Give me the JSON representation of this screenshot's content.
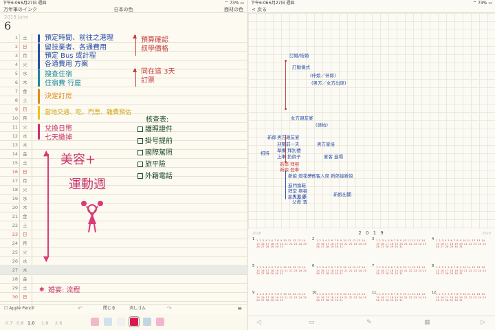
{
  "left": {
    "status": {
      "time": "下午6:06",
      "date": "6月27日 週四",
      "battery": "73%"
    },
    "nav": {
      "left": "万年筆のインク",
      "center": "日本の色",
      "right": "面材の色"
    },
    "year": "2019 June",
    "month": "6",
    "days": [
      {
        "n": "1",
        "w": "土"
      },
      {
        "n": "2",
        "w": "日"
      },
      {
        "n": "3",
        "w": "月"
      },
      {
        "n": "4",
        "w": "火"
      },
      {
        "n": "5",
        "w": "水"
      },
      {
        "n": "6",
        "w": "木"
      },
      {
        "n": "7",
        "w": "金"
      },
      {
        "n": "8",
        "w": "土"
      },
      {
        "n": "9",
        "w": "日"
      },
      {
        "n": "10",
        "w": "月"
      },
      {
        "n": "11",
        "w": "火"
      },
      {
        "n": "12",
        "w": "水"
      },
      {
        "n": "13",
        "w": "木"
      },
      {
        "n": "14",
        "w": "金"
      },
      {
        "n": "15",
        "w": "土"
      },
      {
        "n": "16",
        "w": "日"
      },
      {
        "n": "17",
        "w": "月"
      },
      {
        "n": "18",
        "w": "火"
      },
      {
        "n": "19",
        "w": "水"
      },
      {
        "n": "20",
        "w": "木"
      },
      {
        "n": "21",
        "w": "金"
      },
      {
        "n": "22",
        "w": "土"
      },
      {
        "n": "23",
        "w": "日"
      },
      {
        "n": "24",
        "w": "月"
      },
      {
        "n": "25",
        "w": "火"
      },
      {
        "n": "26",
        "w": "水"
      },
      {
        "n": "27",
        "w": "木"
      },
      {
        "n": "28",
        "w": "金"
      },
      {
        "n": "29",
        "w": "土"
      },
      {
        "n": "30",
        "w": "日"
      }
    ],
    "notes": {
      "n1": "預定時間、前往之港理",
      "n2": "留技業者、各通費用",
      "n3": "預定 Bus 或計程",
      "n4": "各通費用 方案",
      "n5": "搜查住宿",
      "n6": "住宿費 行屋",
      "n7": "決定訂房",
      "n8": "當地交通、吃、門票、雜費預估",
      "n9": "兌換日幣",
      "n10": "七天繳掉",
      "arrow1": "預算確認",
      "arrow1b": "叔學價格",
      "arrow2": "同在這 3天",
      "arrow2b": "訂票",
      "big1": "美容+",
      "big2": "運動週",
      "checklist_title": "核查表:",
      "check": [
        "護照證件",
        "掛号提前",
        "國際駕照",
        "旅平險",
        "外籍電話"
      ],
      "final": "婚宴: 流程"
    },
    "toolbar": {
      "pencil": "Apple Pencil",
      "close": "閉じる",
      "eraser": "消しゴム"
    },
    "sizes": [
      "0.7",
      "0.8",
      "1.0",
      "1.8",
      "2.6"
    ],
    "swatches": [
      "#f4b8cb",
      "#cfe3ee",
      "#f0f0f0",
      "#d9194e",
      "#c3d4e2",
      "#f3b4cf"
    ]
  },
  "right": {
    "status": {
      "time": "下午6:06",
      "date": "6月27日 週四",
      "battery": "73%"
    },
    "nav": {
      "back": "< 戻る"
    },
    "notes": [
      "訂婚/結婚",
      "訂婚儀式",
      "(伴娘／伴郎)",
      "(男方／女方出席)",
      "女方親友宴",
      "(請帖)",
      "男方親友宴",
      "迎娶前一天",
      "準備 拜別禮",
      "上車 扔扇子",
      "新郎 拜祖",
      "新娘 登車",
      "新娘 燈花夢",
      "進門換鞋",
      "拜堂 祭祖",
      "新人進房",
      "新郎",
      "招待",
      "男方家接",
      "宴客 進場",
      "新郎接新娘",
      "新娘出閣",
      "賓客入席",
      "男方 茶",
      "父母 酒"
    ],
    "calendar": {
      "prev": "2018",
      "year": "2 0 1 9",
      "next": "2020",
      "months": [
        "1",
        "2",
        "3",
        "4",
        "5",
        "6",
        "7",
        "8",
        "9",
        "10",
        "11",
        "12"
      ],
      "days": "1 2 3 4 5 6 7 8 9 10 11 12 13 14 15 16 17 18 19 20 21 22 23 24 25 26 27 28 29 30 31"
    }
  }
}
